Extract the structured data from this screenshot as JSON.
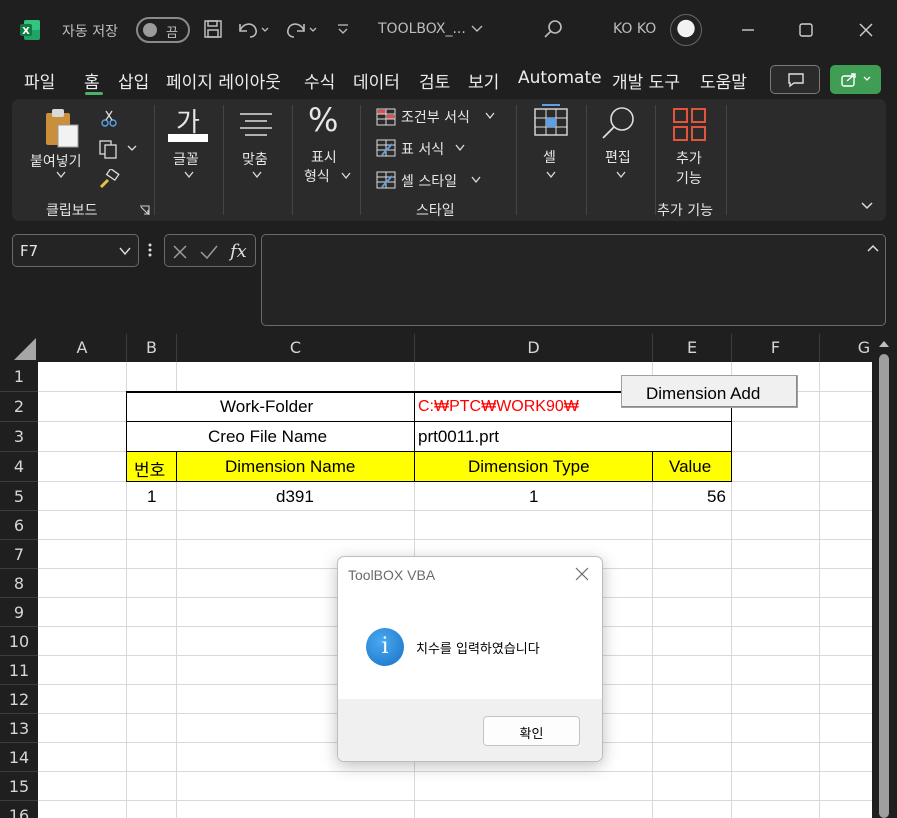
{
  "titlebar": {
    "autosave_label": "자동 저장",
    "autosave_state": "끔",
    "filename": "TOOLBOX_...",
    "user": "KO KO"
  },
  "menu": [
    "파일",
    "홈",
    "삽입",
    "페이지 레이아웃",
    "수식",
    "데이터",
    "검토",
    "보기",
    "Automate",
    "개발 도구",
    "도움말"
  ],
  "ribbon": {
    "paste": "붙여넣기",
    "clipboard_group": "클립보드",
    "font_glyph": "가",
    "font": "글꼴",
    "align": "맞춤",
    "number_sym": "%",
    "number_l1": "표시",
    "number_l2": "형식",
    "cond_format": "조건부 서식",
    "table_format": "표 서식",
    "cell_style": "셀 스타일",
    "style_group": "스타일",
    "cells": "셀",
    "editing": "편집",
    "addins_l1": "추가",
    "addins_l2": "기능",
    "addins_group": "추가 기능"
  },
  "formula_bar": {
    "cell_ref": "F7",
    "value": ""
  },
  "columns": [
    "A",
    "B",
    "C",
    "D",
    "E",
    "F",
    "G"
  ],
  "rows": [
    "1",
    "2",
    "3",
    "4",
    "5",
    "6",
    "7",
    "8",
    "9",
    "10",
    "11",
    "12",
    "13",
    "14",
    "15",
    "16"
  ],
  "sheet": {
    "work_folder_label": "Work-Folder",
    "work_folder_value": "C:₩PTC₩WORK90₩",
    "creo_label": "Creo File Name",
    "creo_value": "prt0011.prt",
    "hdr_no": "번호",
    "hdr_dim_name": "Dimension Name",
    "hdr_dim_type": "Dimension Type",
    "hdr_value": "Value",
    "row_no": "1",
    "row_dim_name": "d391",
    "row_dim_type": "1",
    "row_value": "56",
    "dimension_add_button": "Dimension Add"
  },
  "dialog": {
    "title": "ToolBOX VBA",
    "message": "치수를 입력하였습니다",
    "ok": "확인",
    "icon_glyph": "i"
  },
  "colors": {
    "accent_green": "#3f9e54",
    "header_yellow": "#ffff00",
    "path_red": "#ff0000",
    "info_blue": "#1672c7"
  }
}
